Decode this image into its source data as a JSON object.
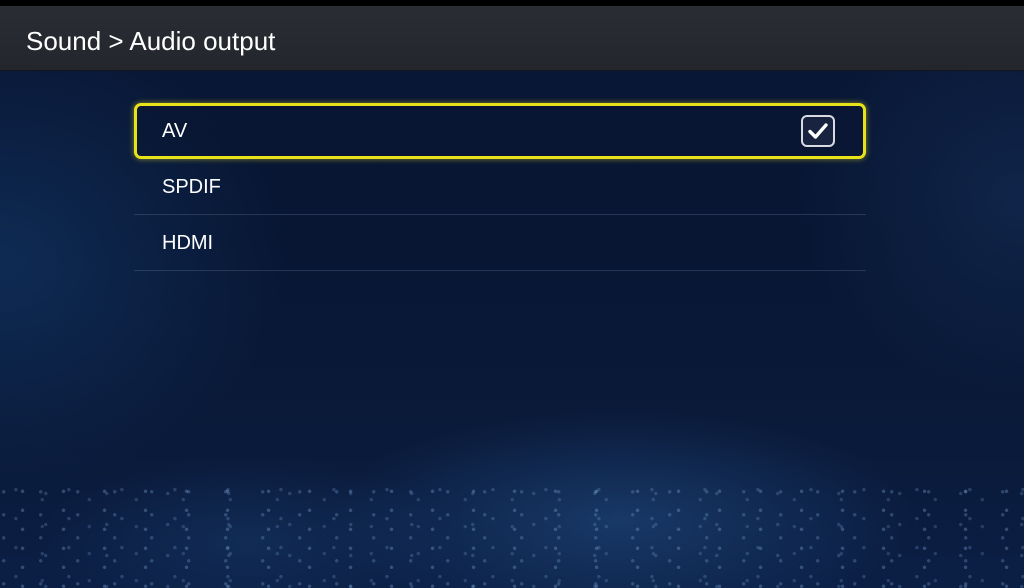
{
  "header": {
    "title": "Sound > Audio output"
  },
  "options": [
    {
      "label": "AV",
      "selected": true,
      "checked": true
    },
    {
      "label": "SPDIF",
      "selected": false,
      "checked": false
    },
    {
      "label": "HDMI",
      "selected": false,
      "checked": false
    }
  ],
  "colors": {
    "focus_border": "#e8e21a",
    "header_bg": "#2a2d33",
    "background": "#081633"
  },
  "icons": {
    "checked": "checkmark-icon"
  }
}
